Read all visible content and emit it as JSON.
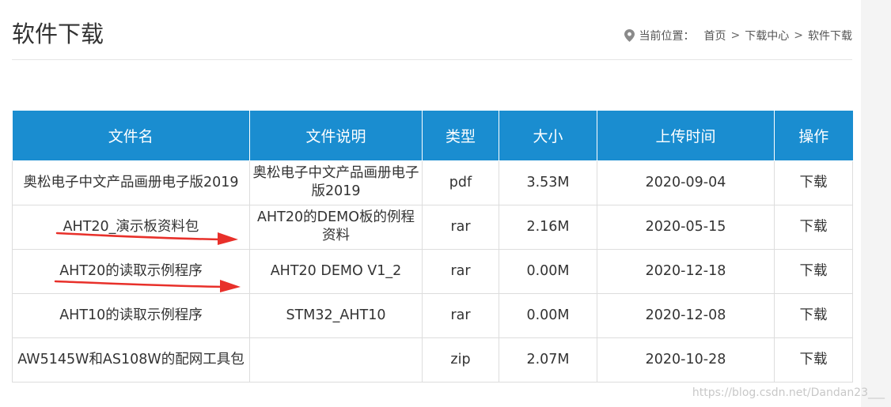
{
  "header": {
    "title": "软件下载",
    "breadcrumb_prefix": "当前位置：",
    "breadcrumb": [
      "首页",
      "下载中心",
      "软件下载"
    ],
    "breadcrumb_sep": ">"
  },
  "table": {
    "columns": [
      "文件名",
      "文件说明",
      "类型",
      "大小",
      "上传时间",
      "操作"
    ],
    "rows": [
      {
        "name": "奥松电子中文产品画册电子版2019",
        "desc": "奥松电子中文产品画册电子版2019",
        "type": "pdf",
        "size": "3.53M",
        "date": "2020-09-04",
        "action": "下载"
      },
      {
        "name": "AHT20_演示板资料包",
        "desc": "AHT20的DEMO板的例程资料",
        "type": "rar",
        "size": "2.16M",
        "date": "2020-05-15",
        "action": "下载"
      },
      {
        "name": "AHT20的读取示例程序",
        "desc": "AHT20 DEMO V1_2",
        "type": "rar",
        "size": "0.00M",
        "date": "2020-12-18",
        "action": "下载"
      },
      {
        "name": "AHT10的读取示例程序",
        "desc": "STM32_AHT10",
        "type": "rar",
        "size": "0.00M",
        "date": "2020-12-08",
        "action": "下载"
      },
      {
        "name": "AW5145W和AS108W的配网工具包",
        "desc": "",
        "type": "zip",
        "size": "2.07M",
        "date": "2020-10-28",
        "action": "下载"
      }
    ]
  },
  "watermark": "https://blog.csdn.net/Dandan23___",
  "colors": {
    "header_bg": "#1a8dd0",
    "annotation_arrow": "#e8302a"
  }
}
